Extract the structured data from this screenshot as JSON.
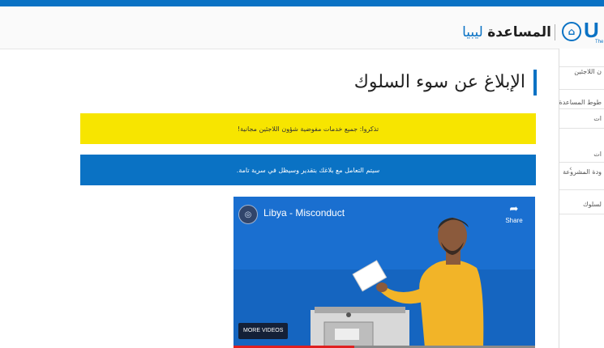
{
  "header": {
    "logo_letters": "U",
    "logo_tagline": "The",
    "site_name": "المساعدة",
    "country": "ليبيا"
  },
  "main": {
    "page_title": "الإبلاغ عن سوء السلوك",
    "yellow_banner": "تذكروا: جميع خدمات مفوضية شؤون اللاجئين مجانية!",
    "blue_banner": "سيتم التعامل مع بلاغك بتقدير وسيظل في سرية تامة."
  },
  "video": {
    "title": "Libya - Misconduct",
    "share_label": "Share",
    "more_videos_label": "MORE VIDEOS",
    "progress": 0.4
  },
  "sidebar": {
    "items": [
      "ن اللاجئين",
      "طوط المساعدة",
      "ات",
      "ات",
      "ودة المشروعة",
      "لسلوك"
    ],
    "chevron": "‹"
  }
}
